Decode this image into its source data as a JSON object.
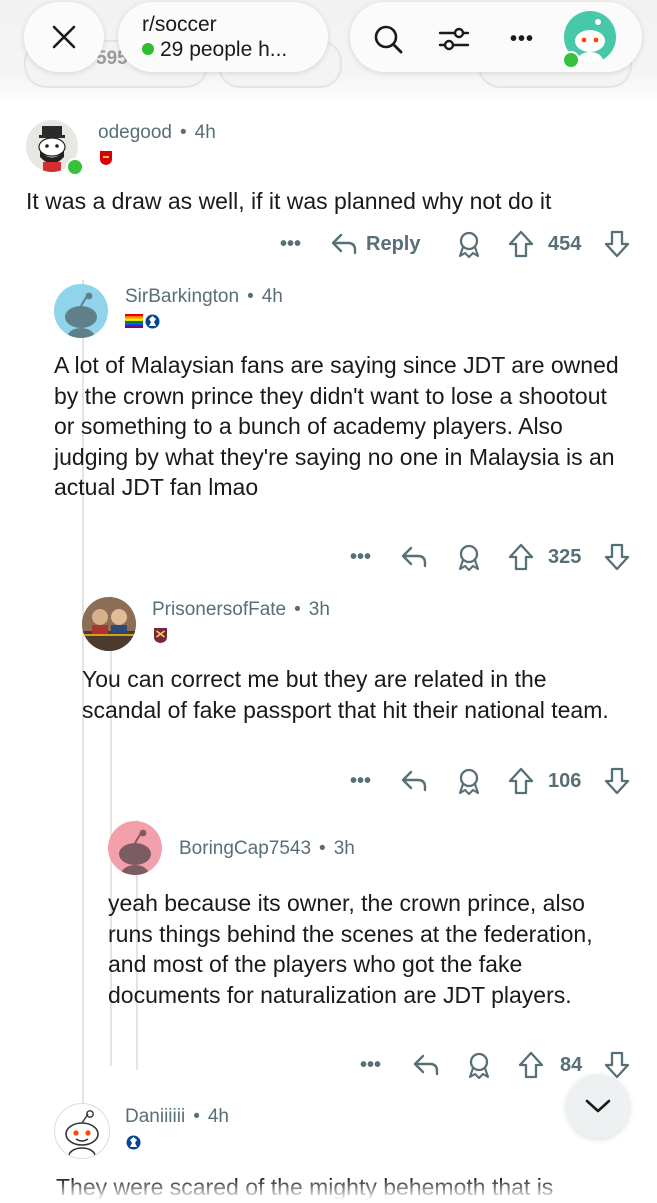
{
  "header": {
    "subreddit": "r/soccer",
    "online": "29 people h...",
    "behind_count": "595",
    "colors": {
      "online_dot": "#2ebd2e",
      "avatar_bg": "#47c9a9"
    }
  },
  "comments": [
    {
      "author": "odegood",
      "age": "4h",
      "flair": "arsenal-badge",
      "body": "It was a draw as well, if it was planned why not do it",
      "reply_label": "Reply",
      "score": "454"
    },
    {
      "author": "SirBarkington",
      "age": "4h",
      "flair": "pride-flag chelsea-badge",
      "body": "A lot of Malaysian fans are saying since JDT are owned by the crown prince they didn't want to lose a shootout or something to a bunch of academy players. Also judging by what they're saying no one in Malaysia is an actual JDT fan lmao",
      "score": "325"
    },
    {
      "author": "PrisonersofFate",
      "age": "3h",
      "flair": "west-ham-badge",
      "body": "You can correct me but they are related in the scandal of fake passport that hit their national team.",
      "score": "106"
    },
    {
      "author": "BoringCap7543",
      "age": "3h",
      "body": "yeah because its owner, the crown prince, also runs things behind the scenes at the federation, and most of the players who got the fake documents for naturalization are JDT players.",
      "score": "84"
    },
    {
      "author": "Daniiiiii",
      "age": "4h",
      "flair": "chelsea-badge",
      "body": "They were scared of the mighty behemoth that is"
    }
  ],
  "separator": "•",
  "more_label": "•••"
}
